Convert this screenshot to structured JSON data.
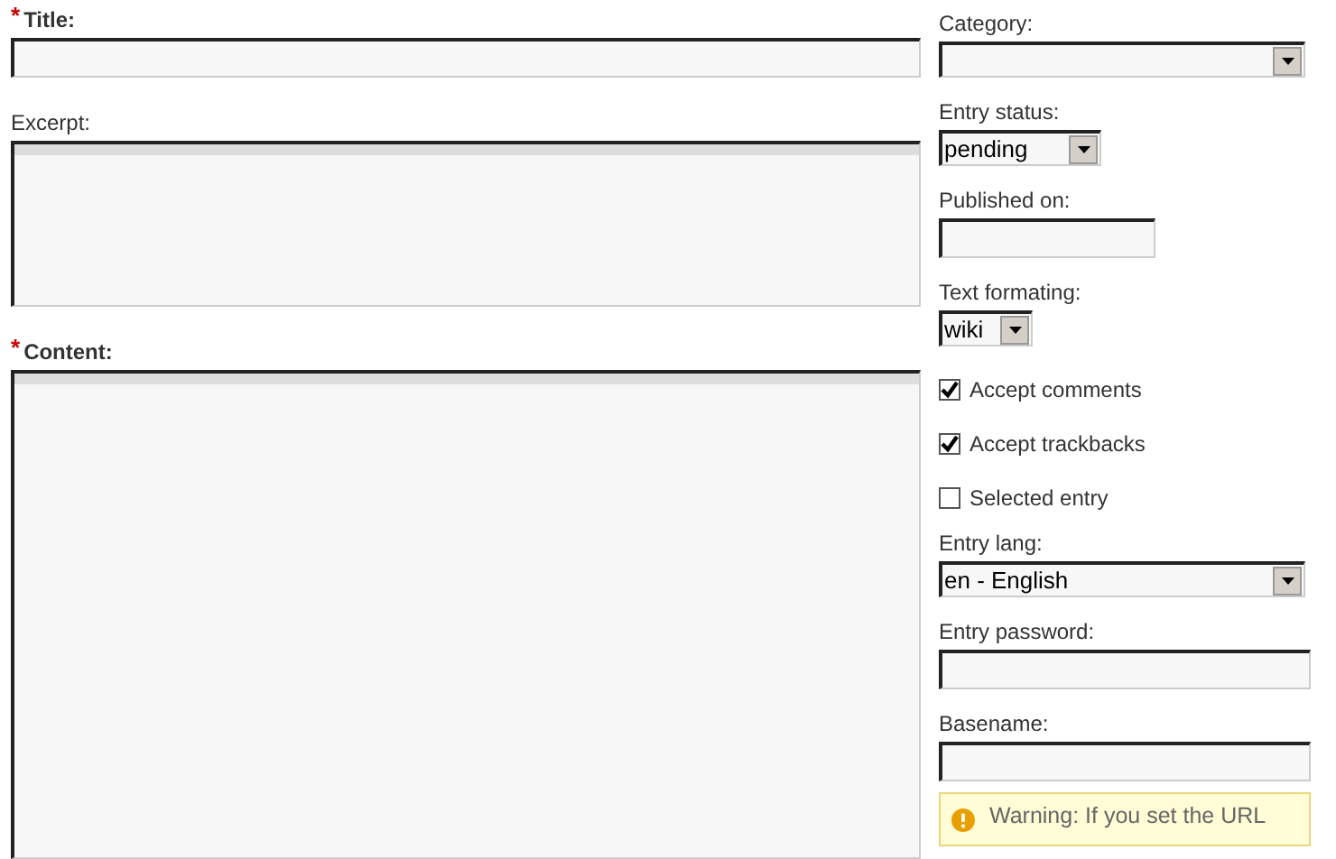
{
  "main_fields": [
    {
      "kind": "input",
      "label": "Title:",
      "required_mark": "*"
    },
    {
      "kind": "textarea",
      "label": "Excerpt:"
    },
    {
      "kind": "textarea",
      "label": "Content:",
      "required_mark": "*"
    }
  ],
  "side_fields": [
    {
      "kind": "select",
      "label": "Category:"
    },
    {
      "kind": "select",
      "label": "Entry status:",
      "value": "pending"
    },
    {
      "kind": "input",
      "label": "Published on:"
    },
    {
      "kind": "select",
      "label": "Text formating:",
      "value": "wiki"
    },
    {
      "kind": "checkbox",
      "label": "Accept comments",
      "checked": true
    },
    {
      "kind": "checkbox",
      "label": "Accept trackbacks",
      "checked": true
    },
    {
      "kind": "checkbox",
      "label": "Selected entry",
      "checked": false
    },
    {
      "kind": "select",
      "label": "Entry lang:",
      "value": "en - English"
    },
    {
      "kind": "input",
      "label": "Entry password:"
    },
    {
      "kind": "input",
      "label": "Basename:"
    }
  ],
  "warning": {
    "text": "Warning: If you set the URL"
  }
}
